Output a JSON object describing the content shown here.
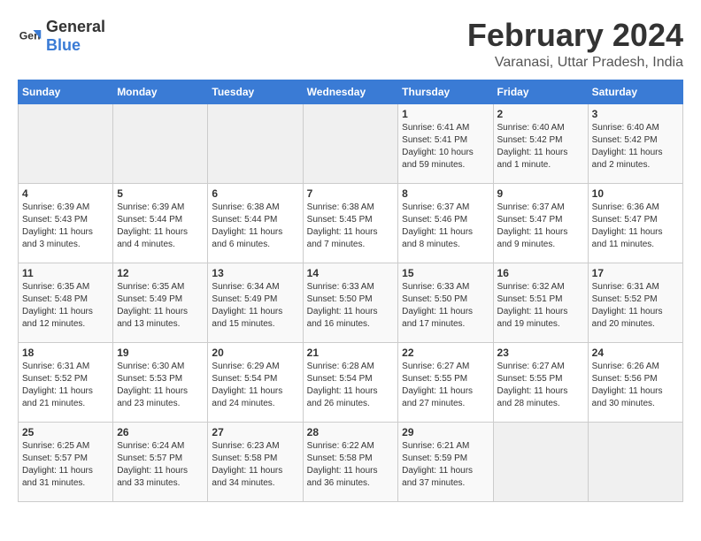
{
  "header": {
    "logo_general": "General",
    "logo_blue": "Blue",
    "title": "February 2024",
    "subtitle": "Varanasi, Uttar Pradesh, India"
  },
  "days_of_week": [
    "Sunday",
    "Monday",
    "Tuesday",
    "Wednesday",
    "Thursday",
    "Friday",
    "Saturday"
  ],
  "weeks": [
    [
      {
        "day": "",
        "info": ""
      },
      {
        "day": "",
        "info": ""
      },
      {
        "day": "",
        "info": ""
      },
      {
        "day": "",
        "info": ""
      },
      {
        "day": "1",
        "info": "Sunrise: 6:41 AM\nSunset: 5:41 PM\nDaylight: 10 hours\nand 59 minutes."
      },
      {
        "day": "2",
        "info": "Sunrise: 6:40 AM\nSunset: 5:42 PM\nDaylight: 11 hours\nand 1 minute."
      },
      {
        "day": "3",
        "info": "Sunrise: 6:40 AM\nSunset: 5:42 PM\nDaylight: 11 hours\nand 2 minutes."
      }
    ],
    [
      {
        "day": "4",
        "info": "Sunrise: 6:39 AM\nSunset: 5:43 PM\nDaylight: 11 hours\nand 3 minutes."
      },
      {
        "day": "5",
        "info": "Sunrise: 6:39 AM\nSunset: 5:44 PM\nDaylight: 11 hours\nand 4 minutes."
      },
      {
        "day": "6",
        "info": "Sunrise: 6:38 AM\nSunset: 5:44 PM\nDaylight: 11 hours\nand 6 minutes."
      },
      {
        "day": "7",
        "info": "Sunrise: 6:38 AM\nSunset: 5:45 PM\nDaylight: 11 hours\nand 7 minutes."
      },
      {
        "day": "8",
        "info": "Sunrise: 6:37 AM\nSunset: 5:46 PM\nDaylight: 11 hours\nand 8 minutes."
      },
      {
        "day": "9",
        "info": "Sunrise: 6:37 AM\nSunset: 5:47 PM\nDaylight: 11 hours\nand 9 minutes."
      },
      {
        "day": "10",
        "info": "Sunrise: 6:36 AM\nSunset: 5:47 PM\nDaylight: 11 hours\nand 11 minutes."
      }
    ],
    [
      {
        "day": "11",
        "info": "Sunrise: 6:35 AM\nSunset: 5:48 PM\nDaylight: 11 hours\nand 12 minutes."
      },
      {
        "day": "12",
        "info": "Sunrise: 6:35 AM\nSunset: 5:49 PM\nDaylight: 11 hours\nand 13 minutes."
      },
      {
        "day": "13",
        "info": "Sunrise: 6:34 AM\nSunset: 5:49 PM\nDaylight: 11 hours\nand 15 minutes."
      },
      {
        "day": "14",
        "info": "Sunrise: 6:33 AM\nSunset: 5:50 PM\nDaylight: 11 hours\nand 16 minutes."
      },
      {
        "day": "15",
        "info": "Sunrise: 6:33 AM\nSunset: 5:50 PM\nDaylight: 11 hours\nand 17 minutes."
      },
      {
        "day": "16",
        "info": "Sunrise: 6:32 AM\nSunset: 5:51 PM\nDaylight: 11 hours\nand 19 minutes."
      },
      {
        "day": "17",
        "info": "Sunrise: 6:31 AM\nSunset: 5:52 PM\nDaylight: 11 hours\nand 20 minutes."
      }
    ],
    [
      {
        "day": "18",
        "info": "Sunrise: 6:31 AM\nSunset: 5:52 PM\nDaylight: 11 hours\nand 21 minutes."
      },
      {
        "day": "19",
        "info": "Sunrise: 6:30 AM\nSunset: 5:53 PM\nDaylight: 11 hours\nand 23 minutes."
      },
      {
        "day": "20",
        "info": "Sunrise: 6:29 AM\nSunset: 5:54 PM\nDaylight: 11 hours\nand 24 minutes."
      },
      {
        "day": "21",
        "info": "Sunrise: 6:28 AM\nSunset: 5:54 PM\nDaylight: 11 hours\nand 26 minutes."
      },
      {
        "day": "22",
        "info": "Sunrise: 6:27 AM\nSunset: 5:55 PM\nDaylight: 11 hours\nand 27 minutes."
      },
      {
        "day": "23",
        "info": "Sunrise: 6:27 AM\nSunset: 5:55 PM\nDaylight: 11 hours\nand 28 minutes."
      },
      {
        "day": "24",
        "info": "Sunrise: 6:26 AM\nSunset: 5:56 PM\nDaylight: 11 hours\nand 30 minutes."
      }
    ],
    [
      {
        "day": "25",
        "info": "Sunrise: 6:25 AM\nSunset: 5:57 PM\nDaylight: 11 hours\nand 31 minutes."
      },
      {
        "day": "26",
        "info": "Sunrise: 6:24 AM\nSunset: 5:57 PM\nDaylight: 11 hours\nand 33 minutes."
      },
      {
        "day": "27",
        "info": "Sunrise: 6:23 AM\nSunset: 5:58 PM\nDaylight: 11 hours\nand 34 minutes."
      },
      {
        "day": "28",
        "info": "Sunrise: 6:22 AM\nSunset: 5:58 PM\nDaylight: 11 hours\nand 36 minutes."
      },
      {
        "day": "29",
        "info": "Sunrise: 6:21 AM\nSunset: 5:59 PM\nDaylight: 11 hours\nand 37 minutes."
      },
      {
        "day": "",
        "info": ""
      },
      {
        "day": "",
        "info": ""
      }
    ]
  ]
}
